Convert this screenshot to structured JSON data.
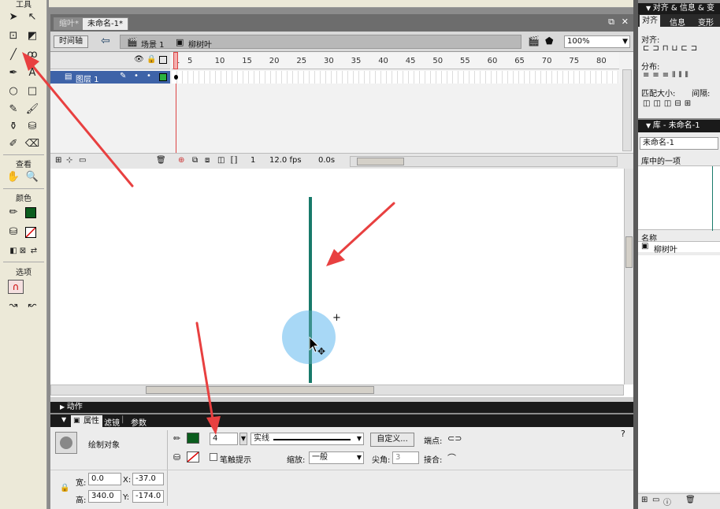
{
  "toolbox": {
    "title": "工具",
    "view_label": "查看",
    "color_label": "颜色",
    "options_label": "选项"
  },
  "document": {
    "tabs": [
      "缩叶*",
      "未命名-1*"
    ],
    "timeline_button": "时间轴",
    "scene": "场景 1",
    "symbol": "柳树叶",
    "zoom": "100%"
  },
  "timeline": {
    "layer_name": "图层 1",
    "frame_numbers": [
      "1",
      "5",
      "10",
      "15",
      "20",
      "25",
      "30",
      "35",
      "40",
      "45",
      "50",
      "55",
      "60",
      "65",
      "70",
      "75",
      "80"
    ],
    "current_frame": "1",
    "fps": "12.0 fps",
    "elapsed": "0.0s"
  },
  "panels": {
    "actions": "动作",
    "tabs": [
      "属性",
      "滤镜",
      "参数"
    ],
    "props": {
      "object_type": "绘制对象",
      "stroke_size": "4",
      "stroke_style": "实线",
      "custom_button": "自定义...",
      "cap_label": "端点:",
      "stroke_hint_label": "笔触提示",
      "scale_label": "缩放:",
      "scale_value": "一般",
      "miter_label": "尖角:",
      "miter_value": "3",
      "join_label": "接合:",
      "w_label": "宽:",
      "w_value": "0.0",
      "x_label": "X:",
      "x_value": "-37.0",
      "h_label": "高:",
      "h_value": "340.0",
      "y_label": "Y:",
      "y_value": "-174.0"
    }
  },
  "right": {
    "align_header": "对齐 & 信息 & 变",
    "align_tabs": [
      "对齐",
      "信息",
      "变形"
    ],
    "align_label": "对齐:",
    "distribute_label": "分布:",
    "match_size_label": "匹配大小:",
    "spacing_label": "间隔:",
    "library_header": "库 - 未命名-1",
    "library_doc": "未命名-1",
    "library_count": "库中的一项",
    "name_column": "名称",
    "library_item": "柳树叶"
  },
  "colors": {
    "stroke_line": "#187a6a",
    "circle_fill": "#a8d8f6",
    "stroke_swatch": "#0b5d1e",
    "annotation_arrow": "#e84040"
  }
}
